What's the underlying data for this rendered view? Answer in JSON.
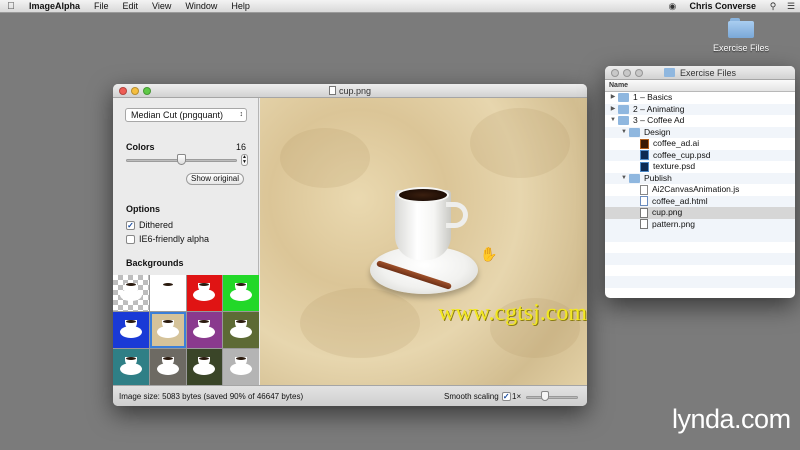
{
  "menubar": {
    "app_name": "ImageAlpha",
    "items": [
      "File",
      "Edit",
      "View",
      "Window",
      "Help"
    ],
    "user": "Chris Converse"
  },
  "desktop": {
    "folder_label": "Exercise Files"
  },
  "main_window": {
    "title": "cup.png",
    "sidebar": {
      "quantizer": "Median Cut (pngquant)",
      "colors_label": "Colors",
      "colors_value": "16",
      "colors_slider_fraction": 0.5,
      "show_original_button": "Show original",
      "options_label": "Options",
      "dithered_label": "Dithered",
      "dithered_checked": true,
      "ie6_label": "IE6-friendly alpha",
      "ie6_checked": false,
      "backgrounds_label": "Backgrounds",
      "backgrounds": [
        {
          "name": "checkerboard",
          "color": "#cfcfcf"
        },
        {
          "name": "white",
          "color": "#ffffff"
        },
        {
          "name": "red",
          "color": "#e01414"
        },
        {
          "name": "green",
          "color": "#22d828"
        },
        {
          "name": "blue",
          "color": "#1a3ad6"
        },
        {
          "name": "texture-paper",
          "color": "#d5c39a"
        },
        {
          "name": "purple",
          "color": "#8a3a8e"
        },
        {
          "name": "moss",
          "color": "#5d6a35"
        },
        {
          "name": "teal",
          "color": "#2f7f86"
        },
        {
          "name": "rubble",
          "color": "#6d6a63"
        },
        {
          "name": "dark-ivy",
          "color": "#3a4528"
        },
        {
          "name": "metal",
          "color": "#b4b4b4"
        }
      ],
      "selected_background_index": 5
    },
    "status": {
      "image_size": "Image size: 5083 bytes (saved 90% of 46647 bytes)",
      "smooth_label": "Smooth scaling",
      "smooth_checked": true,
      "zoom": "1×"
    },
    "canvas_watermark": "www.cgtsj.com"
  },
  "finder_window": {
    "title": "Exercise Files",
    "column_header": "Name",
    "rows": [
      {
        "level": 0,
        "disclosure": "▶",
        "kind": "folder",
        "name": "1 – Basics"
      },
      {
        "level": 0,
        "disclosure": "▶",
        "kind": "folder",
        "name": "2 – Animating"
      },
      {
        "level": 0,
        "disclosure": "▼",
        "kind": "folder",
        "name": "3 – Coffee Ad"
      },
      {
        "level": 1,
        "disclosure": "▼",
        "kind": "folder",
        "name": "Design"
      },
      {
        "level": 2,
        "disclosure": "",
        "kind": "ai",
        "name": "coffee_ad.ai"
      },
      {
        "level": 2,
        "disclosure": "",
        "kind": "psd",
        "name": "coffee_cup.psd"
      },
      {
        "level": 2,
        "disclosure": "",
        "kind": "psd",
        "name": "texture.psd"
      },
      {
        "level": 1,
        "disclosure": "▼",
        "kind": "folder",
        "name": "Publish"
      },
      {
        "level": 2,
        "disclosure": "",
        "kind": "file",
        "name": "Ai2CanvasAnimation.js"
      },
      {
        "level": 2,
        "disclosure": "",
        "kind": "html",
        "name": "coffee_ad.html"
      },
      {
        "level": 2,
        "disclosure": "",
        "kind": "png",
        "name": "cup.png",
        "selected": true
      },
      {
        "level": 2,
        "disclosure": "",
        "kind": "png",
        "name": "pattern.png"
      }
    ]
  },
  "branding": {
    "logo": "lynda.com"
  }
}
